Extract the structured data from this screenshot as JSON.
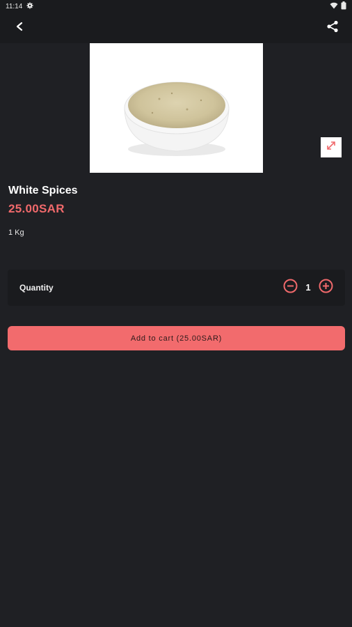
{
  "status_bar": {
    "time": "11:14"
  },
  "product": {
    "name": "White Spices",
    "price": "25.00SAR",
    "unit": "1 Kg"
  },
  "quantity": {
    "label": "Quantity",
    "value": "1"
  },
  "cart": {
    "button_label": "Add to cart (25.00SAR)"
  },
  "colors": {
    "background": "#1f2024",
    "bar": "#1a1b1e",
    "accent": "#f0696b",
    "button": "#f26b6d"
  },
  "icons": [
    "settings-icon",
    "wifi-icon",
    "battery-icon",
    "back-arrow-icon",
    "share-icon",
    "expand-icon",
    "minus-icon",
    "plus-icon"
  ]
}
